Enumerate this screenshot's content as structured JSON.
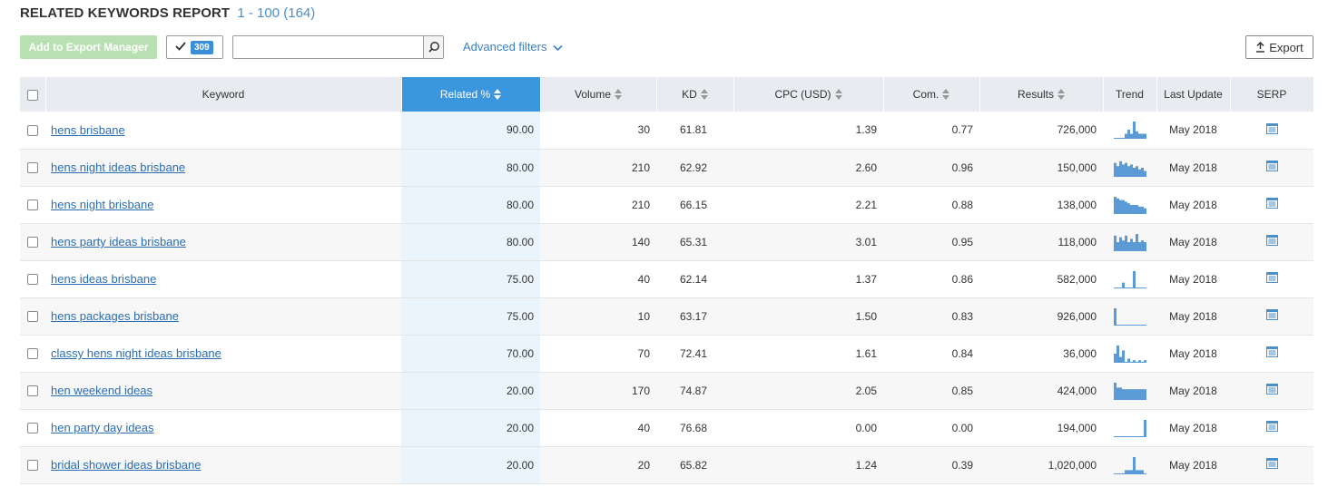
{
  "header": {
    "title": "RELATED KEYWORDS REPORT",
    "range": "1 - 100 (164)"
  },
  "toolbar": {
    "add_export_label": "Add to Export Manager",
    "selected_count": "309",
    "search_value": "",
    "search_placeholder": "",
    "advanced_filters_label": "Advanced filters",
    "export_label": "Export"
  },
  "colors": {
    "accent": "#3b97dd",
    "link": "#2b6db3",
    "trend": "#5b9bd5",
    "add_button": "#b9e0b2"
  },
  "table": {
    "columns": {
      "keyword": "Keyword",
      "related": "Related %",
      "volume": "Volume",
      "kd": "KD",
      "cpc": "CPC (USD)",
      "com": "Com.",
      "results": "Results",
      "trend": "Trend",
      "last_update": "Last Update",
      "serp": "SERP"
    },
    "rows": [
      {
        "keyword": "hens brisbane",
        "related": "90.00",
        "volume": "30",
        "kd": "61.81",
        "cpc": "1.39",
        "com": "0.77",
        "results": "726,000",
        "last_update": "May 2018",
        "trend": [
          0,
          0,
          0,
          0,
          0.25,
          0.5,
          0.25,
          1,
          0.4,
          0.25,
          0.25,
          0.25
        ]
      },
      {
        "keyword": "hens night ideas brisbane",
        "related": "80.00",
        "volume": "210",
        "kd": "62.92",
        "cpc": "2.60",
        "com": "0.96",
        "results": "150,000",
        "last_update": "May 2018",
        "trend": [
          0.8,
          0.6,
          0.9,
          0.7,
          0.8,
          0.6,
          0.7,
          0.5,
          0.6,
          0.4,
          0.5,
          0.3
        ]
      },
      {
        "keyword": "hens night brisbane",
        "related": "80.00",
        "volume": "210",
        "kd": "66.15",
        "cpc": "2.21",
        "com": "0.88",
        "results": "138,000",
        "last_update": "May 2018",
        "trend": [
          1,
          0.9,
          0.8,
          0.8,
          0.7,
          0.6,
          0.5,
          0.5,
          0.5,
          0.4,
          0.4,
          0.3
        ]
      },
      {
        "keyword": "hens party ideas brisbane",
        "related": "80.00",
        "volume": "140",
        "kd": "65.31",
        "cpc": "3.01",
        "com": "0.95",
        "results": "118,000",
        "last_update": "May 2018",
        "trend": [
          0.9,
          0.5,
          0.8,
          0.6,
          0.9,
          0.5,
          0.7,
          0.5,
          1,
          0.5,
          0.6,
          0.5
        ]
      },
      {
        "keyword": "hens ideas brisbane",
        "related": "75.00",
        "volume": "40",
        "kd": "62.14",
        "cpc": "1.37",
        "com": "0.86",
        "results": "582,000",
        "last_update": "May 2018",
        "trend": [
          0,
          0,
          0,
          0.3,
          0,
          0,
          0,
          1,
          0,
          0,
          0,
          0
        ]
      },
      {
        "keyword": "hens packages brisbane",
        "related": "75.00",
        "volume": "10",
        "kd": "63.17",
        "cpc": "1.50",
        "com": "0.83",
        "results": "926,000",
        "last_update": "May 2018",
        "trend": [
          1,
          0,
          0,
          0,
          0,
          0,
          0,
          0,
          0,
          0,
          0,
          0
        ]
      },
      {
        "keyword": "classy hens night ideas brisbane",
        "related": "70.00",
        "volume": "70",
        "kd": "72.41",
        "cpc": "1.61",
        "com": "0.84",
        "results": "36,000",
        "last_update": "May 2018",
        "trend": [
          0.5,
          1,
          0.3,
          0.7,
          0,
          0.2,
          0,
          0.1,
          0,
          0.1,
          0,
          0.1
        ]
      },
      {
        "keyword": "hen weekend ideas",
        "related": "20.00",
        "volume": "170",
        "kd": "74.87",
        "cpc": "2.05",
        "com": "0.85",
        "results": "424,000",
        "last_update": "May 2018",
        "trend": [
          1,
          0.7,
          0.7,
          0.6,
          0.6,
          0.6,
          0.6,
          0.6,
          0.6,
          0.6,
          0.6,
          0.6
        ]
      },
      {
        "keyword": "hen party day ideas",
        "related": "20.00",
        "volume": "40",
        "kd": "76.68",
        "cpc": "0.00",
        "com": "0.00",
        "results": "194,000",
        "last_update": "May 2018",
        "trend": [
          0,
          0,
          0,
          0,
          0,
          0,
          0,
          0,
          0,
          0,
          0,
          1
        ]
      },
      {
        "keyword": "bridal shower ideas brisbane",
        "related": "20.00",
        "volume": "20",
        "kd": "65.82",
        "cpc": "1.24",
        "com": "0.39",
        "results": "1,020,000",
        "last_update": "May 2018",
        "trend": [
          0,
          0,
          0,
          0,
          0.2,
          0.2,
          0.2,
          1,
          0.2,
          0.2,
          0.2,
          0
        ]
      }
    ]
  }
}
